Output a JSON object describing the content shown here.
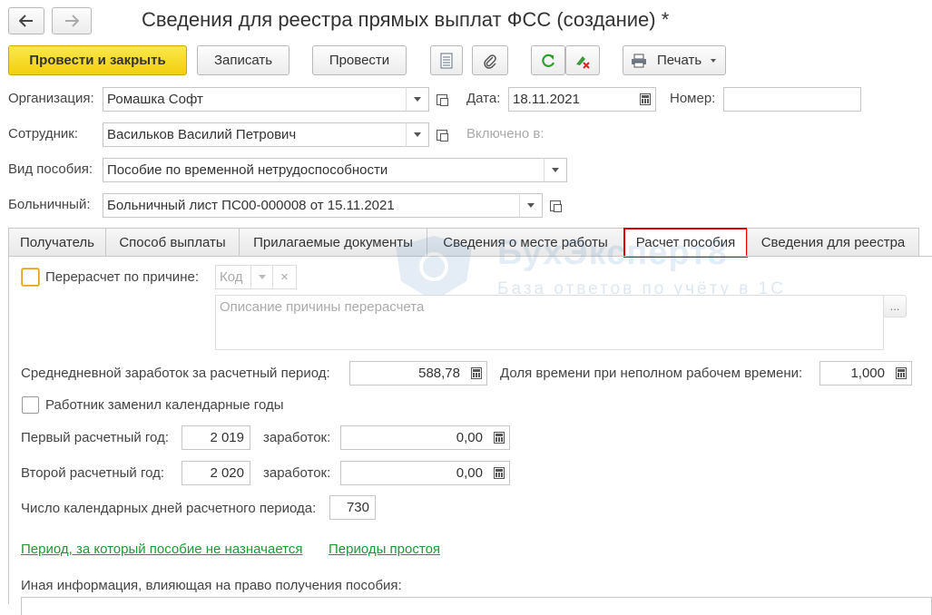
{
  "window": {
    "title": "Сведения для реестра прямых выплат ФСС (создание) *"
  },
  "toolbar": {
    "post_close_label": "Провести и закрыть",
    "save_label": "Записать",
    "post_label": "Провести",
    "print_label": "Печать"
  },
  "header": {
    "organization_label": "Организация:",
    "organization_value": "Ромашка Софт",
    "date_label": "Дата:",
    "date_value": "18.11.2021",
    "number_label": "Номер:",
    "number_value": "",
    "employee_label": "Сотрудник:",
    "employee_value": "Васильков Василий Петрович",
    "included_label": "Включено в:",
    "benefit_type_label": "Вид пособия:",
    "benefit_type_value": "Пособие по временной нетрудоспособности",
    "sick_leave_label": "Больничный:",
    "sick_leave_value": "Больничный лист ПС00-000008 от 15.11.2021"
  },
  "tabs": [
    {
      "label": "Получатель"
    },
    {
      "label": "Способ выплаты"
    },
    {
      "label": "Прилагаемые документы"
    },
    {
      "label": "Сведения о месте работы"
    },
    {
      "label": "Расчет пособия",
      "active": true
    },
    {
      "label": "Сведения для реестра"
    }
  ],
  "calc": {
    "recalc_label": "Перерасчет по причине:",
    "recalc_checked": false,
    "code_placeholder": "Код",
    "reason_placeholder": "Описание причины перерасчета",
    "reason_more": "...",
    "avg_earnings_label": "Среднедневной заработок за расчетный период:",
    "avg_earnings_value": "588,78",
    "time_share_label": "Доля времени при неполном рабочем времени:",
    "time_share_value": "1,000",
    "replaced_years_label": "Работник заменил календарные годы",
    "replaced_years_checked": false,
    "first_year_label": "Первый расчетный год:",
    "first_year_value": "2 019",
    "first_earnings_label": "заработок:",
    "first_earnings_value": "0,00",
    "second_year_label": "Второй расчетный год:",
    "second_year_value": "2 020",
    "second_earnings_label": "заработок:",
    "second_earnings_value": "0,00",
    "days_label": "Число календарных дней расчетного периода:",
    "days_value": "730",
    "link_not_assigned": "Период, за который пособие не назначается",
    "link_downtime": "Периоды простоя",
    "other_info_label": "Иная информация, влияющая на право получения пособия:"
  },
  "watermark": {
    "brand": "БухЭксперт8",
    "tagline": "База ответов по учёту в 1С"
  },
  "colors": {
    "primary_button": "#f5d31c",
    "active_tab_border": "#e00000",
    "link": "#1d9a36"
  }
}
